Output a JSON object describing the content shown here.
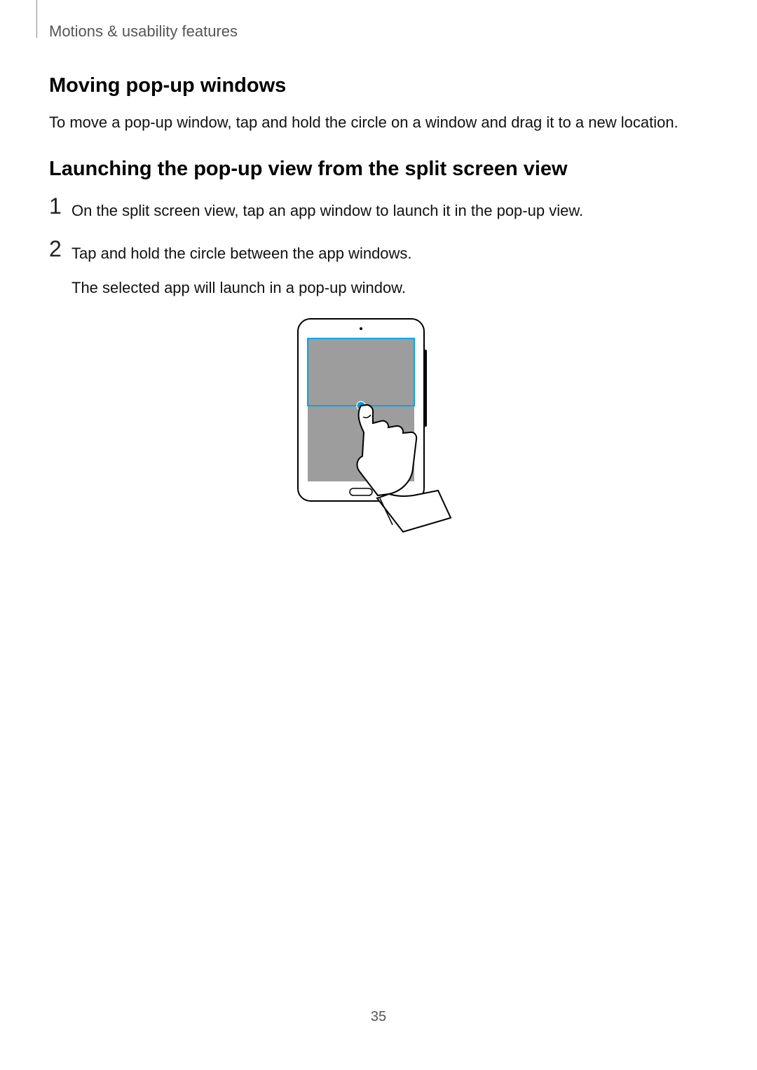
{
  "section_header": "Motions & usability features",
  "headings": {
    "moving_popup": "Moving pop-up windows",
    "launching_popup": "Launching the pop-up view from the split screen view"
  },
  "paragraphs": {
    "moving_popup_body": "To move a pop-up window, tap and hold the circle on a window and drag it to a new location."
  },
  "list": {
    "item1_num": "1",
    "item1_text": "On the split screen view, tap an app window to launch it in the pop-up view.",
    "item2_num": "2",
    "item2_text_l1": "Tap and hold the circle between the app windows.",
    "item2_text_l2": "The selected app will launch in a pop-up window."
  },
  "page_number": "35"
}
